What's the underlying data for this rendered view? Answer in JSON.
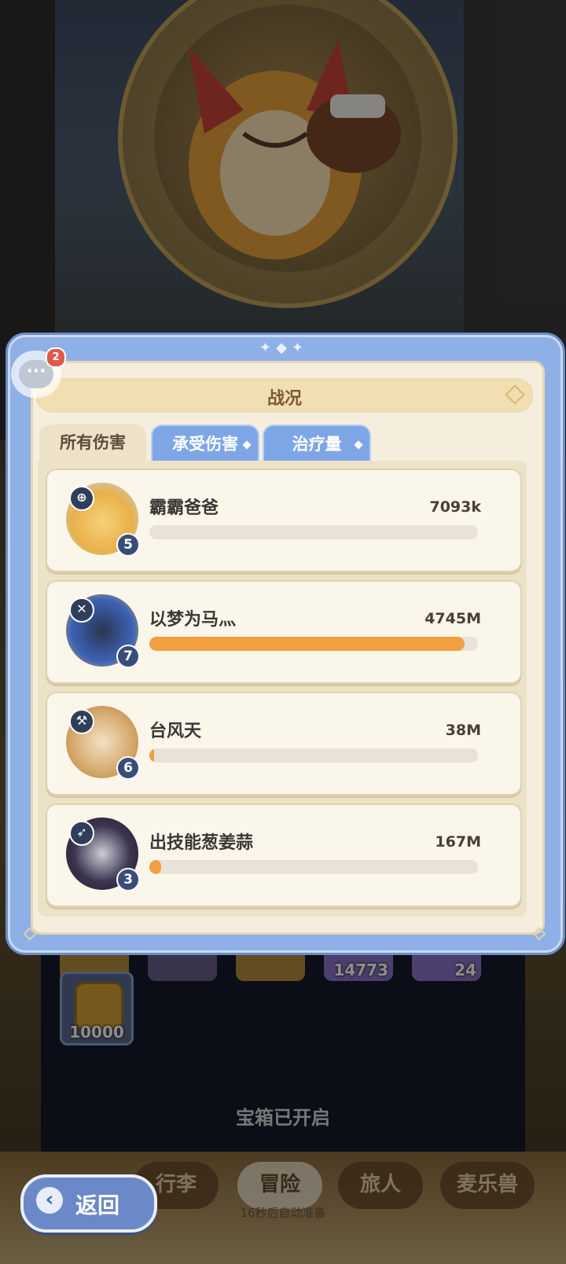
{
  "dialog": {
    "title": "战况",
    "tabs": [
      {
        "label": "所有伤害",
        "active": true
      },
      {
        "label": "承受伤害",
        "active": false
      },
      {
        "label": "治疗量",
        "active": false
      }
    ]
  },
  "chat": {
    "badge_count": "2"
  },
  "players": [
    {
      "name": "霸霸爸爸",
      "value": "7093k",
      "level": "5",
      "class_icon": "shield-cross-icon",
      "fill_fraction": 0.0,
      "avatar_color": "#f2c76a"
    },
    {
      "name": "以梦为马灬",
      "value": "4745M",
      "level": "7",
      "class_icon": "crossed-swords-icon",
      "fill_fraction": 0.96,
      "avatar_color": "#3c62b5"
    },
    {
      "name": "台风天",
      "value": "38M",
      "level": "6",
      "class_icon": "hammer-icon",
      "fill_fraction": 0.01,
      "avatar_color": "#d4a86a"
    },
    {
      "name": "出技能葱姜蒜",
      "value": "167M",
      "level": "3",
      "class_icon": "bow-icon",
      "fill_fraction": 0.035,
      "avatar_color": "#3b3550"
    }
  ],
  "background": {
    "slot_values": [
      "14773",
      "24"
    ],
    "coin_value": "10000",
    "chest_status": "宝箱已开启",
    "nav": [
      "行李",
      "冒险",
      "旅人",
      "麦乐兽"
    ],
    "nav_sub": "16秒后自动准备",
    "back_label": "返回"
  },
  "colors": {
    "bar_fill": "#f0a040",
    "tab_active": "#ede2c8",
    "tab_inactive": "#7ea6e6",
    "dialog_frame": "#8fb0e6"
  }
}
